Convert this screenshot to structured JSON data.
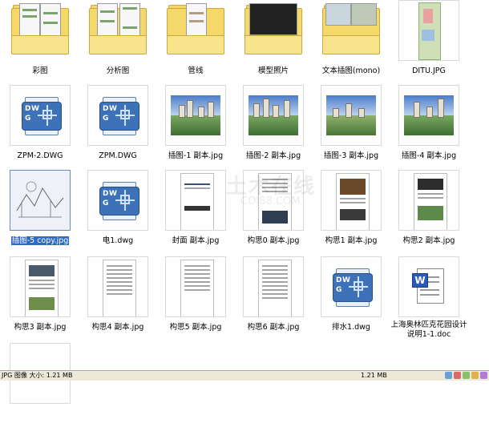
{
  "files": [
    {
      "label": "彩图",
      "icon": "folder-icon"
    },
    {
      "label": "分析图",
      "icon": "folder-icon"
    },
    {
      "label": "管线",
      "icon": "folder-icon"
    },
    {
      "label": "模型照片",
      "icon": "folder-icon"
    },
    {
      "label": "文本插图(mono)",
      "icon": "folder-icon"
    },
    {
      "label": "DITU.JPG",
      "icon": "map-thumbnail"
    },
    {
      "label": "ZPM-2.DWG",
      "icon": "dwg-file-icon"
    },
    {
      "label": "ZPM.DWG",
      "icon": "dwg-file-icon"
    },
    {
      "label": "插图-1 副本.jpg",
      "icon": "image-thumbnail"
    },
    {
      "label": "插图-2 副本.jpg",
      "icon": "image-thumbnail"
    },
    {
      "label": "插图-3 副本.jpg",
      "icon": "image-thumbnail"
    },
    {
      "label": "插图-4 副本.jpg",
      "icon": "image-thumbnail"
    },
    {
      "label": "插图-5 copy.jpg",
      "icon": "sketch-thumbnail",
      "selected": true
    },
    {
      "label": "电1.dwg",
      "icon": "dwg-file-icon"
    },
    {
      "label": "封面 副本.jpg",
      "icon": "cover-thumbnail"
    },
    {
      "label": "构思0 副本.jpg",
      "icon": "document-thumbnail"
    },
    {
      "label": "构思1 副本.jpg",
      "icon": "document-thumbnail"
    },
    {
      "label": "构思2 副本.jpg",
      "icon": "document-thumbnail"
    },
    {
      "label": "构思3 副本.jpg",
      "icon": "document-thumbnail"
    },
    {
      "label": "构思4 副本.jpg",
      "icon": "document-thumbnail"
    },
    {
      "label": "构思5 副本.jpg",
      "icon": "document-thumbnail"
    },
    {
      "label": "构思6 副本.jpg",
      "icon": "document-thumbnail"
    },
    {
      "label": "排水1.dwg",
      "icon": "dwg-file-icon"
    },
    {
      "label": "上海奥林匹克花园设计说明1-1.doc",
      "icon": "word-doc-icon"
    },
    {
      "label": "",
      "icon": "document-thumbnail"
    }
  ],
  "watermark": {
    "text": "土木在线",
    "sub": "COI88.COM"
  },
  "status": {
    "left": "JPG 图像 大小: 1.21 MB",
    "right": "1.21 MB"
  },
  "colors": {
    "selection": "#316ac5",
    "folder": "#f4d96a",
    "dwg": "#3d72b8"
  }
}
